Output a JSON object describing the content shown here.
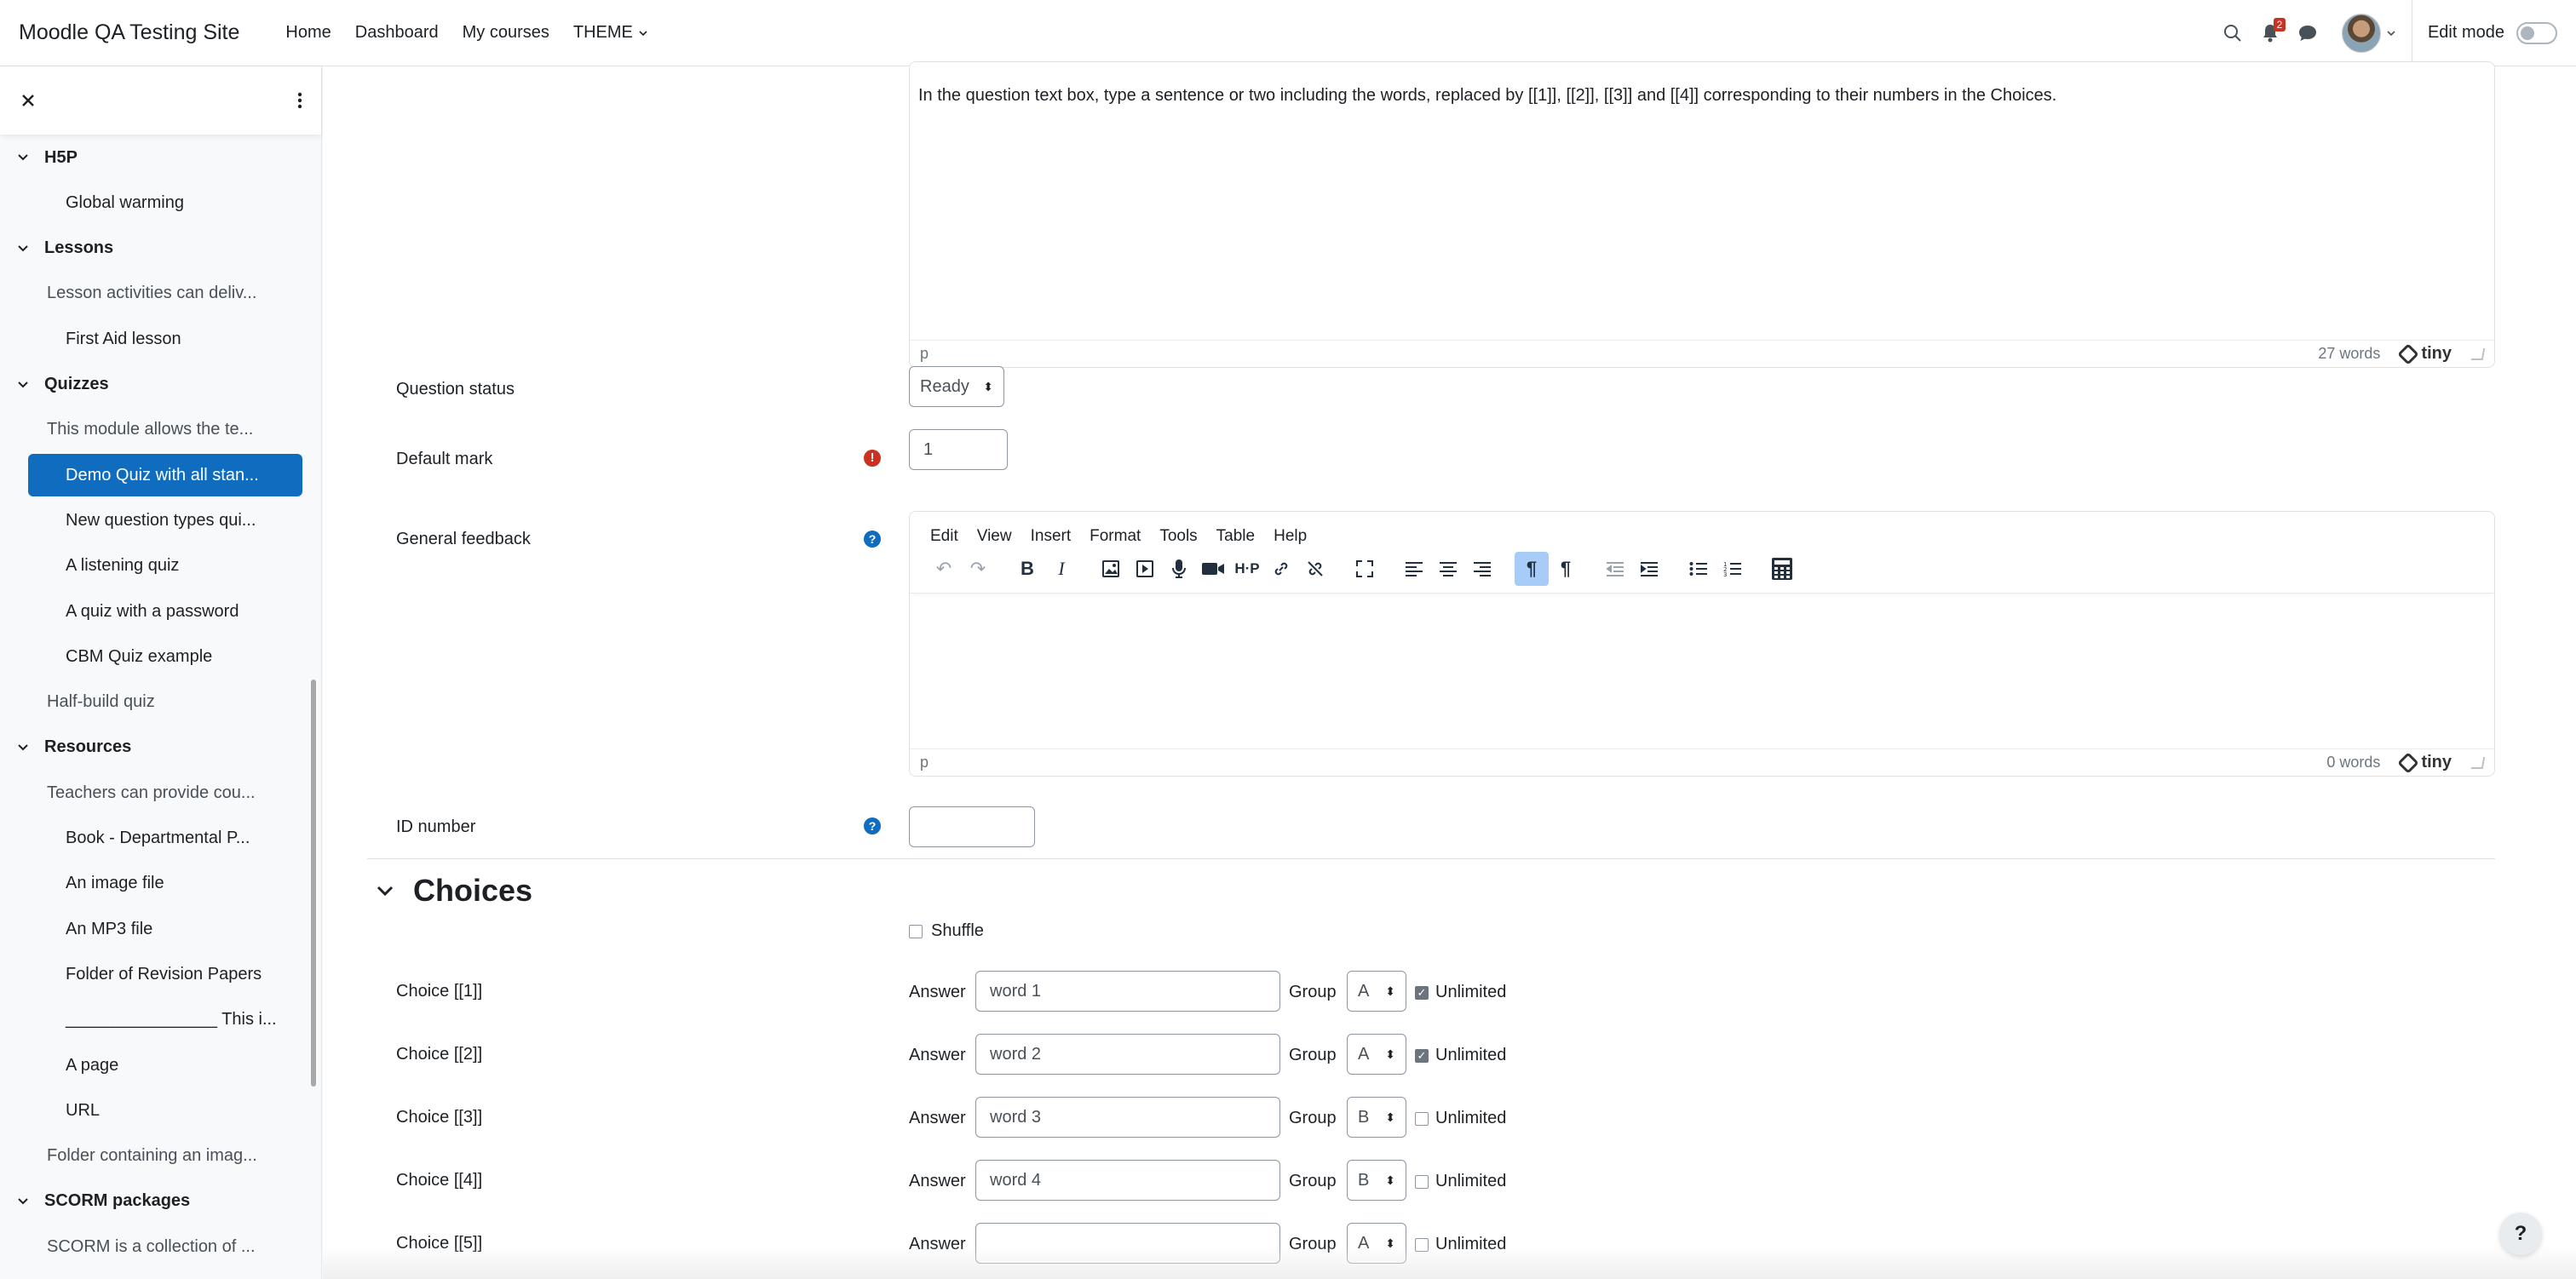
{
  "navbar": {
    "brand": "Moodle QA Testing Site",
    "links": [
      "Home",
      "Dashboard",
      "My courses",
      "THEME"
    ],
    "notification_count": "2",
    "edit_mode_label": "Edit mode"
  },
  "drawer": {
    "items": [
      {
        "type": "section",
        "label": "H5P"
      },
      {
        "type": "sub",
        "label": "Global warming"
      },
      {
        "type": "section",
        "label": "Lessons"
      },
      {
        "type": "mod",
        "label": "Lesson activities can deliv..."
      },
      {
        "type": "sub",
        "label": "First Aid lesson"
      },
      {
        "type": "section",
        "label": "Quizzes"
      },
      {
        "type": "mod",
        "label": "This module allows the te..."
      },
      {
        "type": "sub",
        "label": "Demo Quiz with all stan...",
        "active": true
      },
      {
        "type": "sub",
        "label": "New question types qui..."
      },
      {
        "type": "sub",
        "label": "A listening quiz"
      },
      {
        "type": "sub",
        "label": "A quiz with a password"
      },
      {
        "type": "sub",
        "label": "CBM Quiz example"
      },
      {
        "type": "mod",
        "label": "Half-build quiz"
      },
      {
        "type": "section",
        "label": "Resources"
      },
      {
        "type": "mod",
        "label": "Teachers can provide cou..."
      },
      {
        "type": "sub",
        "label": "Book - Departmental P..."
      },
      {
        "type": "sub",
        "label": "An image file"
      },
      {
        "type": "sub",
        "label": "An MP3 file"
      },
      {
        "type": "sub",
        "label": "Folder of Revision Papers"
      },
      {
        "type": "sub",
        "label": "________________ This i..."
      },
      {
        "type": "sub",
        "label": "A page"
      },
      {
        "type": "sub",
        "label": "URL"
      },
      {
        "type": "mod",
        "label": "Folder containing an imag..."
      },
      {
        "type": "section",
        "label": "SCORM packages"
      },
      {
        "type": "mod",
        "label": "SCORM is a collection of ..."
      }
    ]
  },
  "question_text_editor": {
    "content": "In the question text box, type a sentence or two including the words, replaced by [[1]], [[2]], [[3]] and [[4]] corresponding to their numbers in the Choices.",
    "path": "p",
    "word_count": "27 words",
    "logo": "tiny"
  },
  "question_status": {
    "label": "Question status",
    "value": "Ready"
  },
  "default_mark": {
    "label": "Default mark",
    "value": "1"
  },
  "general_feedback": {
    "label": "General feedback",
    "menu": [
      "Edit",
      "View",
      "Insert",
      "Format",
      "Tools",
      "Table",
      "Help"
    ],
    "path": "p",
    "word_count": "0 words",
    "logo": "tiny"
  },
  "id_number": {
    "label": "ID number",
    "value": ""
  },
  "choices_section": {
    "title": "Choices",
    "shuffle_label": "Shuffle",
    "answer_label": "Answer",
    "group_label": "Group",
    "unlimited_label": "Unlimited",
    "rows": [
      {
        "label": "Choice [[1]]",
        "answer": "word 1",
        "group": "A",
        "unlimited": true
      },
      {
        "label": "Choice [[2]]",
        "answer": "word 2",
        "group": "A",
        "unlimited": true
      },
      {
        "label": "Choice [[3]]",
        "answer": "word 3",
        "group": "B",
        "unlimited": false
      },
      {
        "label": "Choice [[4]]",
        "answer": "word 4",
        "group": "B",
        "unlimited": false
      },
      {
        "label": "Choice [[5]]",
        "answer": "",
        "group": "A",
        "unlimited": false
      }
    ]
  },
  "help_button": "?",
  "colors": {
    "accent": "#0f6cbf",
    "required": "#ca3120",
    "toolbar_active": "#a6ccf7"
  }
}
